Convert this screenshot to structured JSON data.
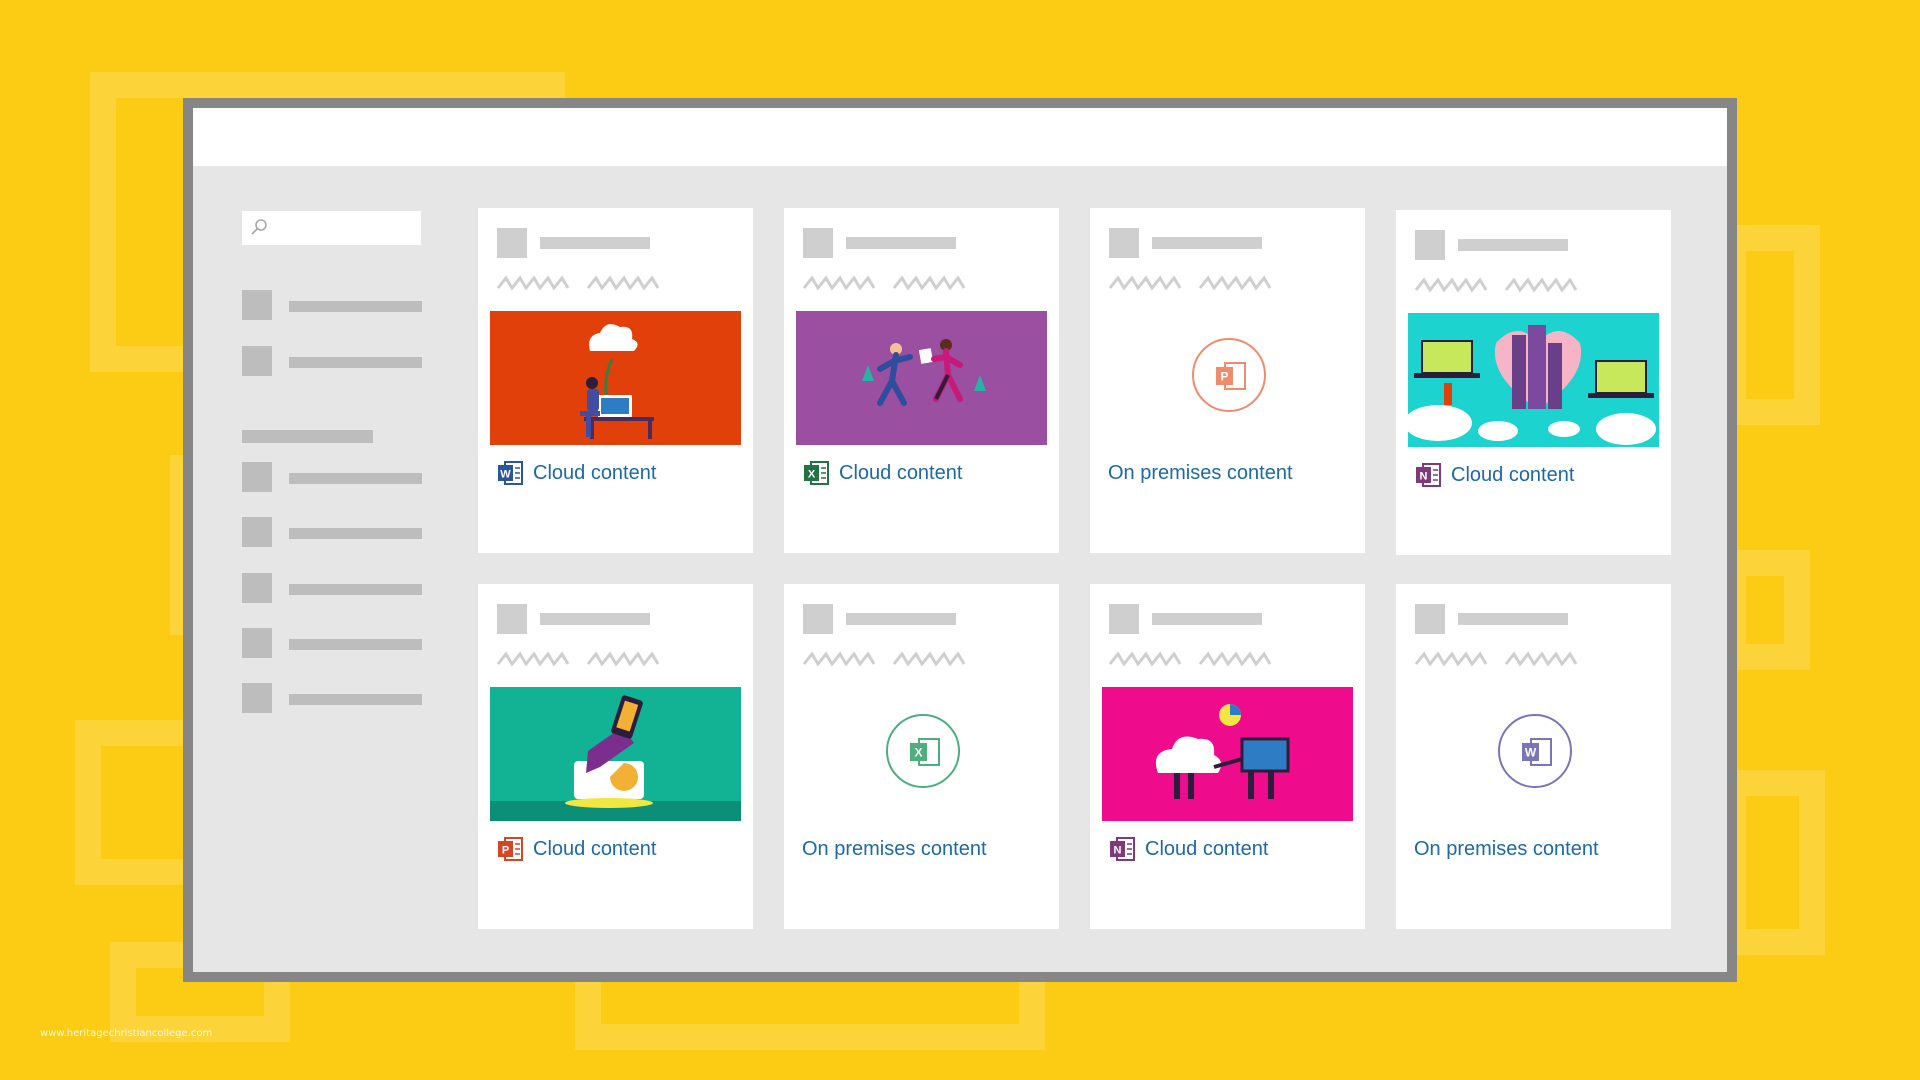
{
  "colors": {
    "background": "#FCCB14",
    "window_frame": "#868686",
    "link_text": "#1C6AA5",
    "word": "#2B579A",
    "excel": "#217346",
    "powerpoint": "#D24726",
    "onenote": "#80397B"
  },
  "watermark": "www.heritagechristiancollege.com",
  "sidebar": {
    "search_icon": "search-icon"
  },
  "cards": [
    {
      "label": "Cloud content",
      "app": "word",
      "visual": "thumbnail-orange-person-cloud"
    },
    {
      "label": "Cloud content",
      "app": "excel",
      "visual": "thumbnail-purple-runners"
    },
    {
      "label": "On premises content",
      "app": "powerpoint",
      "visual": "powerpoint-circle-icon"
    },
    {
      "label": "Cloud content",
      "app": "onenote",
      "visual": "thumbnail-teal-city-heart"
    },
    {
      "label": "Cloud content",
      "app": "powerpoint",
      "visual": "thumbnail-green-tablet-hand"
    },
    {
      "label": "On premises content",
      "app": "excel",
      "visual": "excel-circle-icon"
    },
    {
      "label": "Cloud content",
      "app": "onenote",
      "visual": "thumbnail-magenta-cloud-monitor"
    },
    {
      "label": "On premises content",
      "app": "word",
      "visual": "word-circle-icon"
    }
  ]
}
